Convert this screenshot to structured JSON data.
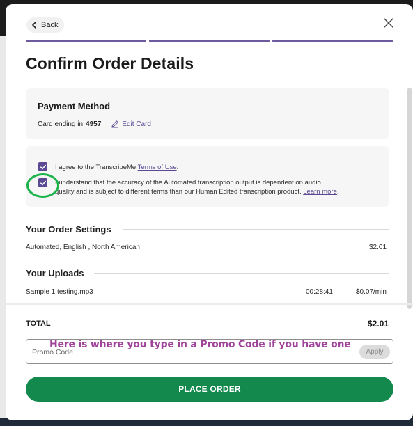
{
  "header": {
    "back_label": "Back",
    "title": "Confirm Order Details",
    "progress_steps": 3
  },
  "payment": {
    "title": "Payment Method",
    "card_prefix": "Card ending in",
    "card_last4": "4957",
    "edit_label": "Edit Card"
  },
  "agreements": {
    "item1_prefix": "I agree to the TranscribeMe",
    "item1_link": "Terms of Use",
    "item1_suffix": ".",
    "item1_checked": true,
    "item2_line1": "I understand that the accuracy of the Automated transcription output is dependent on audio",
    "item2_line2": "quality and is subject to different terms than our Human Edited transcription product.",
    "item2_link": "Learn more",
    "item2_suffix": ".",
    "item2_checked": true
  },
  "order_settings": {
    "title": "Your Order Settings",
    "description": "Automated, English , North American",
    "price": "$2.01"
  },
  "uploads": {
    "title": "Your Uploads",
    "items": [
      {
        "file": "Sample 1 testing.mp3",
        "duration": "00:28:41",
        "rate": "$0.07/min"
      }
    ]
  },
  "total": {
    "label": "TOTAL",
    "value": "$2.01"
  },
  "promo": {
    "placeholder": "Promo Code",
    "apply_label": "Apply"
  },
  "annotation": {
    "text": "Here is where you type in a Promo Code if you have one",
    "color": "#a0439b",
    "circle_color": "#1bb34a"
  },
  "place_order_label": "PLACE ORDER",
  "colors": {
    "accent": "#5b4a93",
    "primary_button": "#14894e"
  }
}
